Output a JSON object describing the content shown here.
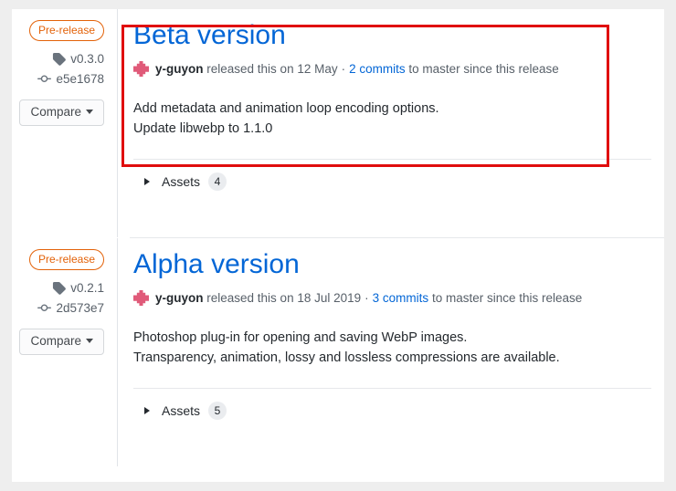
{
  "page": {
    "background_color": "#eeeeee",
    "card_color": "#ffffff",
    "accent_link_color": "#0366d6",
    "pre_release_color": "#e36209",
    "annotation_color": "#e00d0d"
  },
  "releases": [
    {
      "badge": "Pre-release",
      "tag": "v0.3.0",
      "commit": "e5e1678",
      "compare_label": "Compare",
      "title": "Beta version",
      "author": "y-guyon",
      "released_text": "released this on",
      "date": "12 May",
      "separator": "·",
      "commits_link": "2 commits",
      "commits_suffix": "to master since this release",
      "notes": [
        "Add metadata and animation loop encoding options.",
        "Update libwebp to 1.1.0"
      ],
      "assets_label": "Assets",
      "assets_count": "4"
    },
    {
      "badge": "Pre-release",
      "tag": "v0.2.1",
      "commit": "2d573e7",
      "compare_label": "Compare",
      "title": "Alpha version",
      "author": "y-guyon",
      "released_text": "released this on",
      "date": "18 Jul 2019",
      "separator": "·",
      "commits_link": "3 commits",
      "commits_suffix": "to master since this release",
      "notes": [
        "Photoshop plug-in for opening and saving WebP images.",
        "Transparency, animation, lossy and lossless compressions are available."
      ],
      "assets_label": "Assets",
      "assets_count": "5"
    }
  ]
}
